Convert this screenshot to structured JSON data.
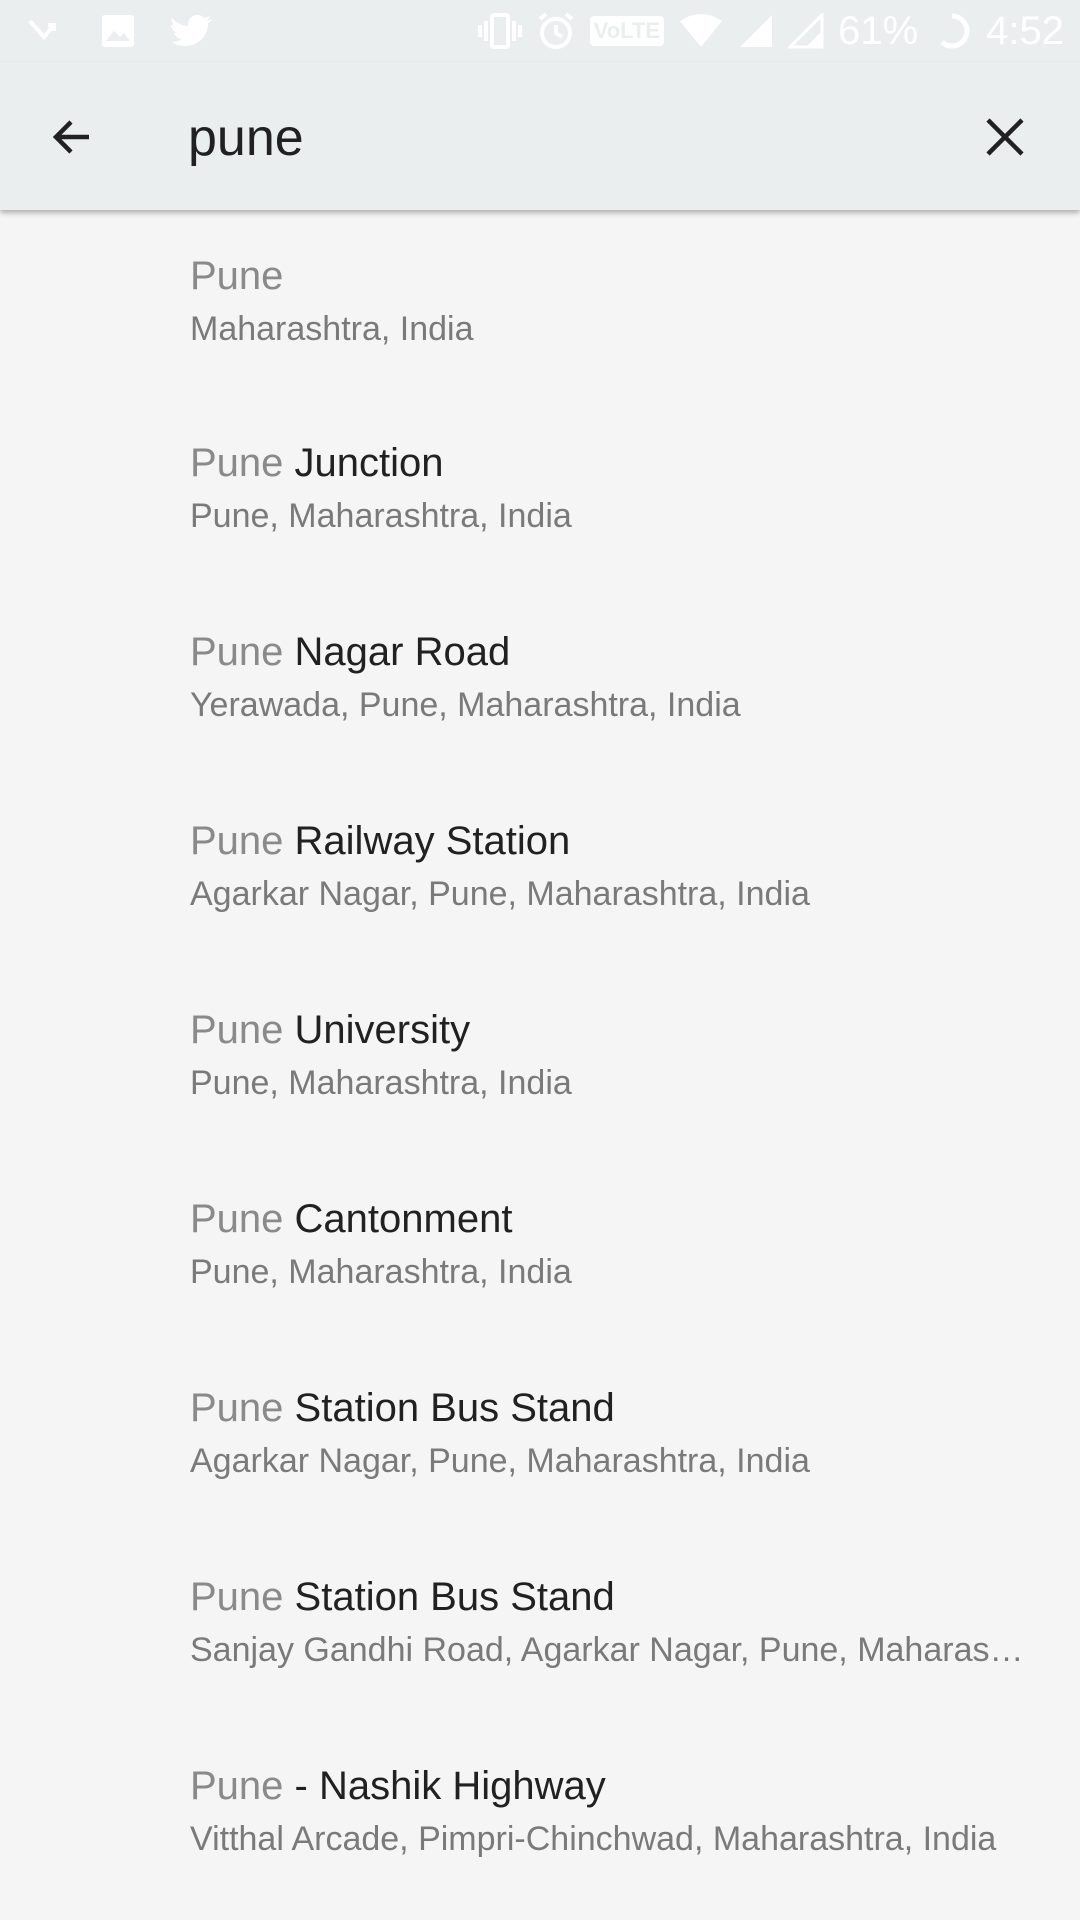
{
  "status_bar": {
    "battery_percent": "61%",
    "time": "4:52",
    "volte_label": "VoLTE",
    "icons_left": [
      "missed-call-icon",
      "image-icon",
      "twitter-icon"
    ],
    "icons_right": [
      "vibrate-icon",
      "alarm-icon",
      "volte-icon",
      "wifi-icon",
      "signal-icon",
      "signal-icon-2",
      "battery-icon"
    ]
  },
  "search": {
    "query": "pune",
    "back_icon": "arrow-left-icon",
    "clear_icon": "close-icon"
  },
  "results": [
    {
      "match": "Pune",
      "rest": "",
      "subtitle": "Maharashtra, India"
    },
    {
      "match": "Pune",
      "rest": " Junction",
      "subtitle": "Pune, Maharashtra, India"
    },
    {
      "match": "Pune",
      "rest": " Nagar Road",
      "subtitle": "Yerawada, Pune, Maharashtra, India"
    },
    {
      "match": "Pune",
      "rest": " Railway Station",
      "subtitle": "Agarkar Nagar, Pune, Maharashtra, India"
    },
    {
      "match": "Pune",
      "rest": " University",
      "subtitle": "Pune, Maharashtra, India"
    },
    {
      "match": "Pune",
      "rest": " Cantonment",
      "subtitle": "Pune, Maharashtra, India"
    },
    {
      "match": "Pune",
      "rest": " Station Bus Stand",
      "subtitle": "Agarkar Nagar, Pune, Maharashtra, India"
    },
    {
      "match": "Pune",
      "rest": " Station Bus Stand",
      "subtitle": "Sanjay Gandhi Road, Agarkar Nagar, Pune, Maharashtra, India"
    },
    {
      "match": "Pune",
      "rest": " - Nashik Highway",
      "subtitle": "Vitthal Arcade, Pimpri-Chinchwad, Maharashtra, India"
    }
  ]
}
